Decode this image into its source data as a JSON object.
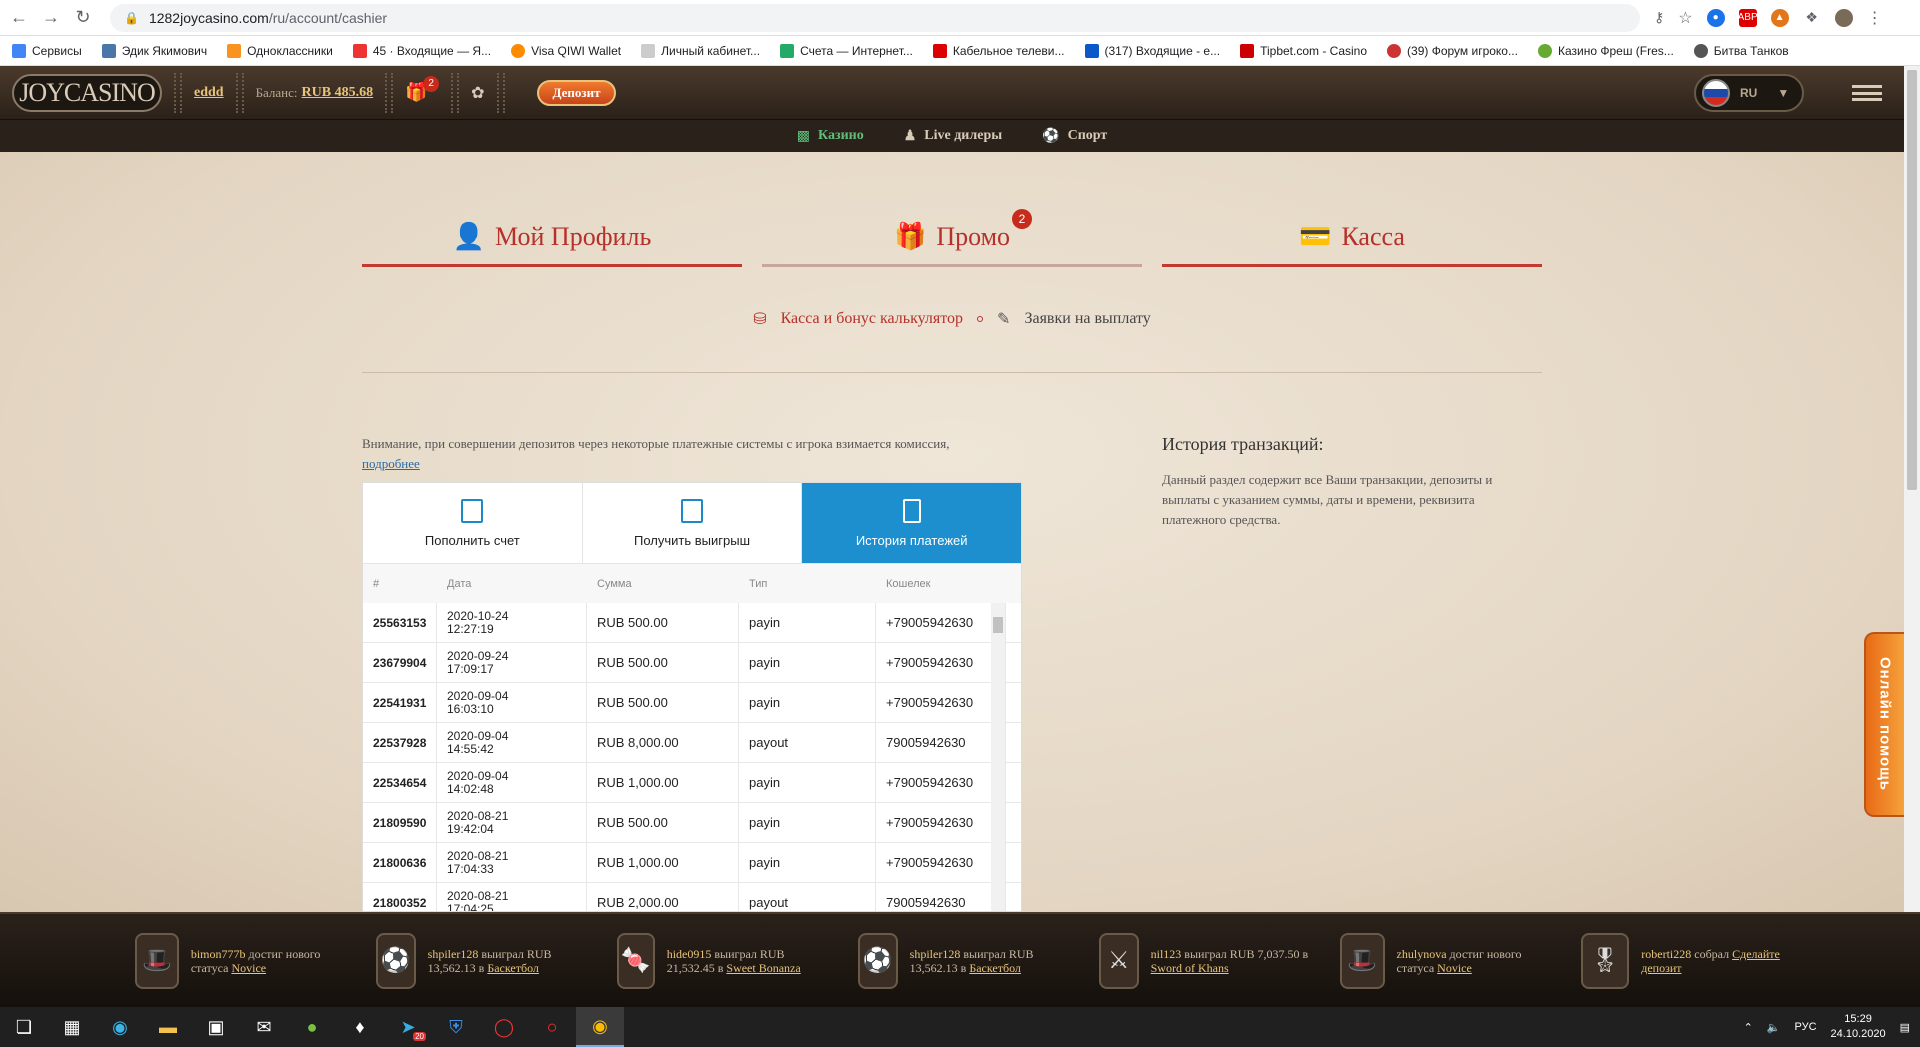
{
  "browser": {
    "url_host": "1282joycasino.com",
    "url_path": "/ru/account/cashier",
    "bookmarks": [
      {
        "label": "Сервисы",
        "color": "#4285f4"
      },
      {
        "label": "Эдик Якимович",
        "color": "#4a76a8"
      },
      {
        "label": "Одноклассники",
        "color": "#f7931e"
      },
      {
        "label": "45 · Входящие — Я...",
        "color": "#e33"
      },
      {
        "label": "Visa QIWI Wallet",
        "color": "#ff8c00"
      },
      {
        "label": "Личный кабинет...",
        "color": "#999"
      },
      {
        "label": "Счета — Интернет...",
        "color": "#2a6"
      },
      {
        "label": "Кабельное телеви...",
        "color": "#d00"
      },
      {
        "label": "(317) Входящие - е...",
        "color": "#0a58ca"
      },
      {
        "label": "Tipbet.com - Casino",
        "color": "#c00"
      },
      {
        "label": "(39) Форум игроко...",
        "color": "#c33"
      },
      {
        "label": "Казино Фреш (Fres...",
        "color": "#6a3"
      },
      {
        "label": "Битва Танков",
        "color": "#555"
      }
    ]
  },
  "header": {
    "logo": "JOYCASINO",
    "username": "eddd",
    "balance_label": "Баланс:",
    "balance_value": "RUB 485.68",
    "gift_count": "2",
    "deposit_label": "Депозит",
    "lang": "RU"
  },
  "nav": {
    "casino": "Казино",
    "live": "Live дилеры",
    "sport": "Спорт"
  },
  "account_tabs": {
    "profile": "Мой Профиль",
    "promo": "Промо",
    "promo_badge": "2",
    "cashier": "Касса"
  },
  "subtabs": {
    "cashier_calc": "Касса и бонус калькулятор",
    "withdraw_requests": "Заявки на выплату"
  },
  "notice": {
    "text": "Внимание, при совершении депозитов через некоторые платежные системы с игрока взимается комиссия,",
    "link": "подробнее"
  },
  "cashier": {
    "tabs": {
      "deposit": "Пополнить счет",
      "withdraw": "Получить выигрыш",
      "history": "История платежей"
    },
    "columns": [
      "#",
      "Дата",
      "Сумма",
      "Тип",
      "Кошелек"
    ],
    "rows": [
      {
        "id": "25563153",
        "date": "2020-10-24",
        "time": "12:27:19",
        "amount": "RUB 500.00",
        "type": "payin",
        "wallet": "+79005942630"
      },
      {
        "id": "23679904",
        "date": "2020-09-24",
        "time": "17:09:17",
        "amount": "RUB 500.00",
        "type": "payin",
        "wallet": "+79005942630"
      },
      {
        "id": "22541931",
        "date": "2020-09-04",
        "time": "16:03:10",
        "amount": "RUB 500.00",
        "type": "payin",
        "wallet": "+79005942630"
      },
      {
        "id": "22537928",
        "date": "2020-09-04",
        "time": "14:55:42",
        "amount": "RUB 8,000.00",
        "type": "payout",
        "wallet": "79005942630"
      },
      {
        "id": "22534654",
        "date": "2020-09-04",
        "time": "14:02:48",
        "amount": "RUB 1,000.00",
        "type": "payin",
        "wallet": "+79005942630"
      },
      {
        "id": "21809590",
        "date": "2020-08-21",
        "time": "19:42:04",
        "amount": "RUB 500.00",
        "type": "payin",
        "wallet": "+79005942630"
      },
      {
        "id": "21800636",
        "date": "2020-08-21",
        "time": "17:04:33",
        "amount": "RUB 1,000.00",
        "type": "payin",
        "wallet": "+79005942630"
      },
      {
        "id": "21800352",
        "date": "2020-08-21",
        "time": "17:04:25",
        "amount": "RUB 2,000.00",
        "type": "payout",
        "wallet": "79005942630"
      }
    ]
  },
  "history": {
    "title": "История транзакций:",
    "desc": "Данный раздел содержит все Ваши транзакции, депозиты и выплаты с указанием суммы, даты и времени, реквизита платежного средства."
  },
  "help_label": "Онлайн помощь",
  "winners": [
    {
      "user": "bimon777b",
      "action": "достиг нового статуса",
      "target": "Novice",
      "icon": "hat-icon"
    },
    {
      "user": "shpiler128",
      "action": "выиграл RUB 13,562.13 в",
      "target": "Баскетбол",
      "icon": "ball-icon"
    },
    {
      "user": "hide0915",
      "action": "выиграл RUB 21,532.45 в",
      "target": "Sweet Bonanza",
      "icon": "candy-icon"
    },
    {
      "user": "shpiler128",
      "action": "выиграл RUB 13,562.13 в",
      "target": "Баскетбол",
      "icon": "ball-icon"
    },
    {
      "user": "nil123",
      "action": "выиграл RUB 7,037.50 в",
      "target": "Sword of Khans",
      "icon": "warrior-icon"
    },
    {
      "user": "zhulynova",
      "action": "достиг нового статуса",
      "target": "Novice",
      "icon": "hat-icon"
    },
    {
      "user": "roberti228",
      "action": "собрал",
      "target": "Сделайте депозит",
      "icon": "medal-icon"
    }
  ],
  "taskbar": {
    "lang": "РУС",
    "time": "15:29",
    "date": "24.10.2020",
    "telegram_badge": "20"
  }
}
